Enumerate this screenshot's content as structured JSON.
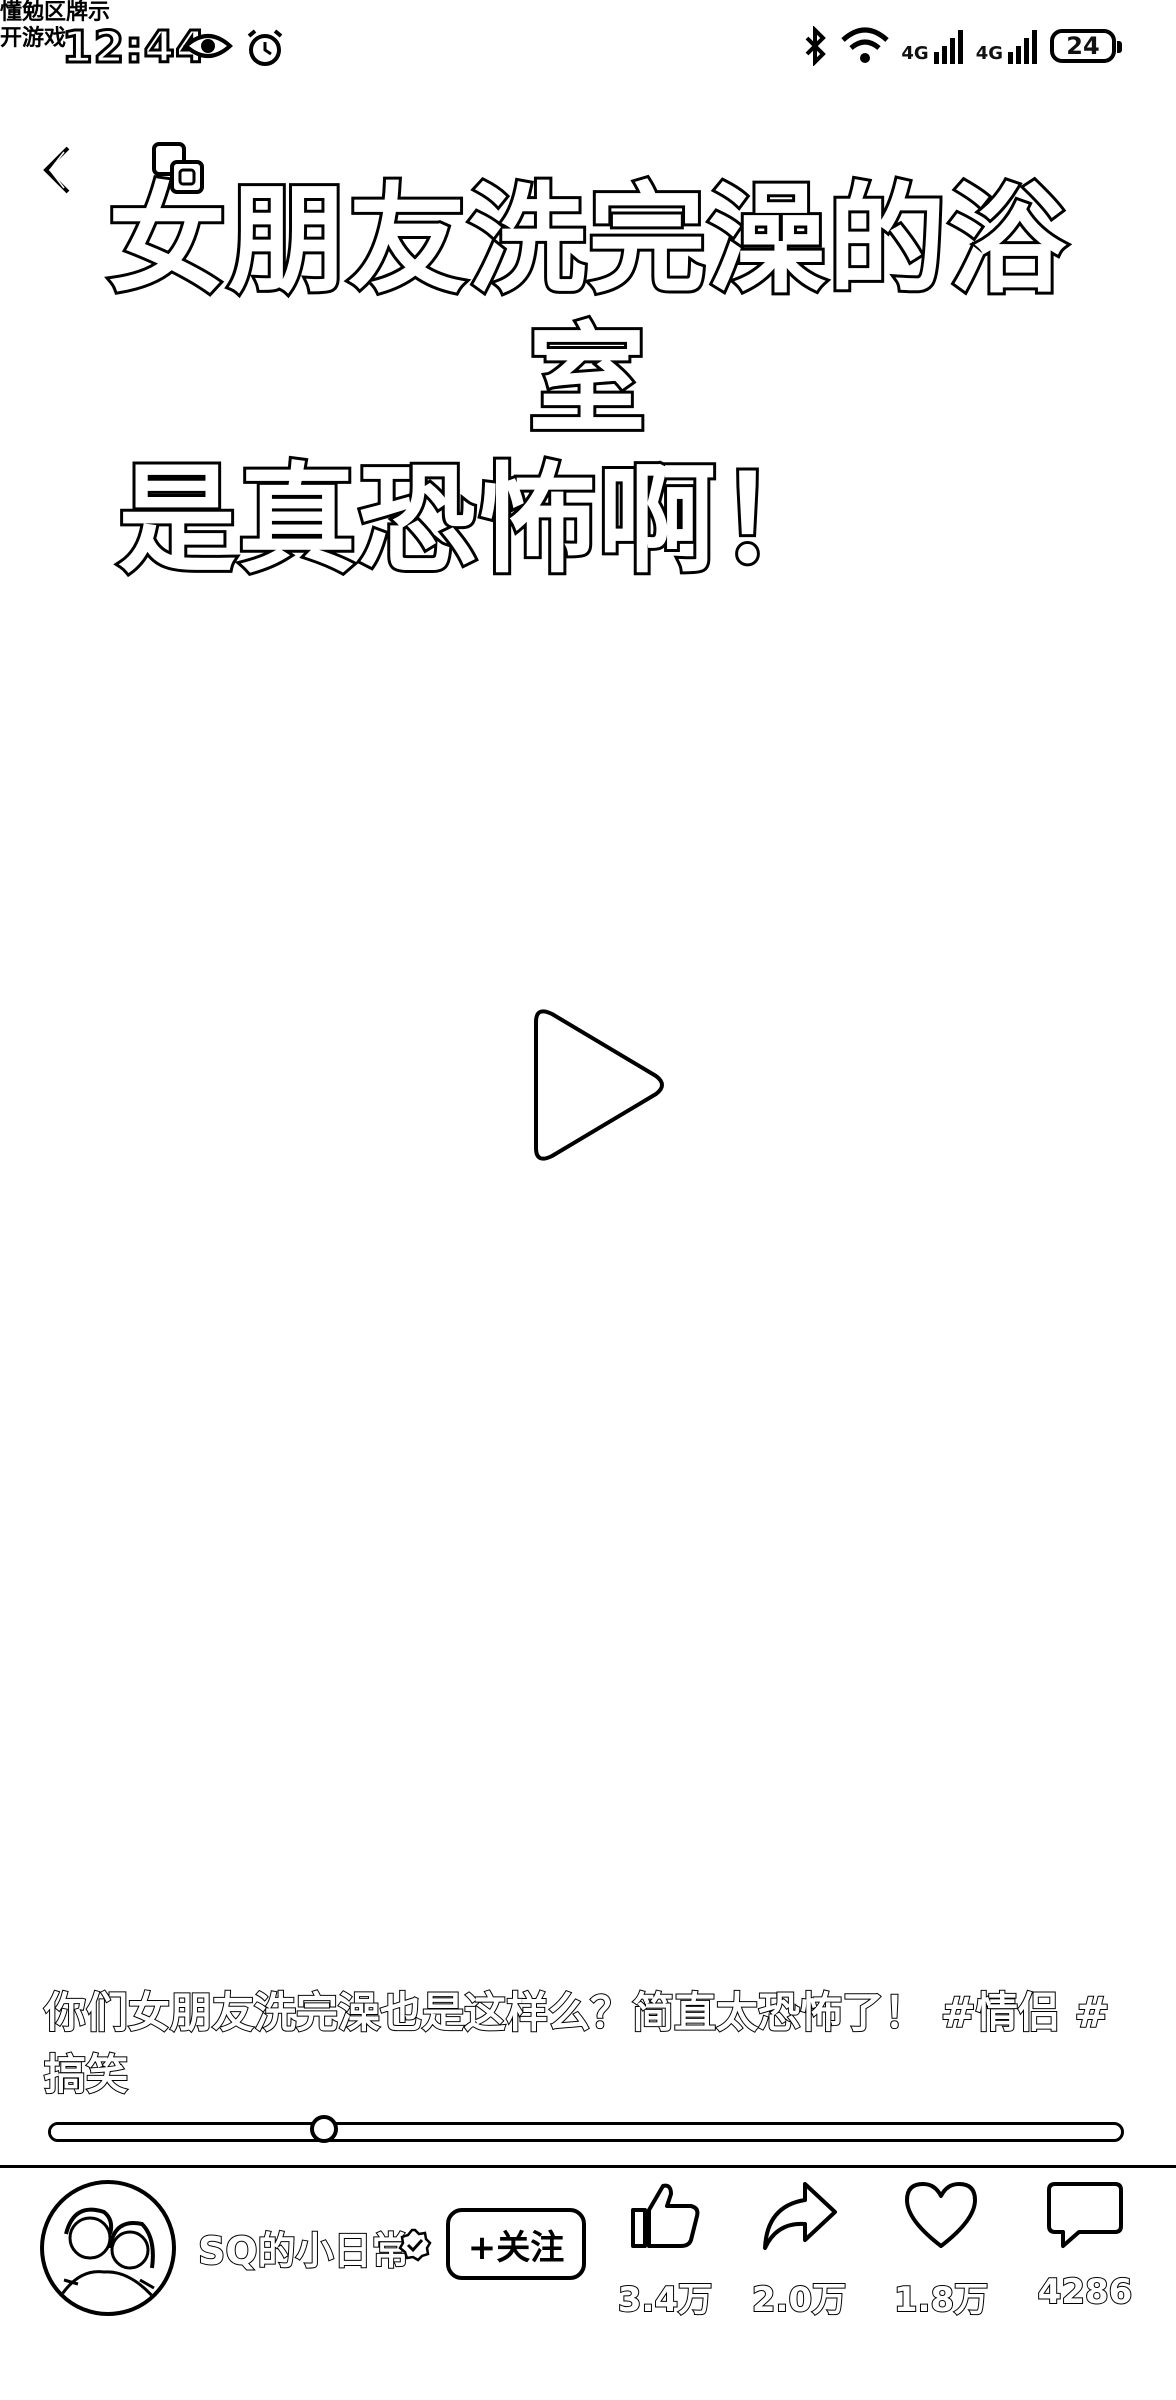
{
  "status_bar": {
    "notification_text": "懂勉区牌示\n开游戏",
    "time": "12:44",
    "network_1": "4G",
    "network_2": "4G",
    "battery": "24"
  },
  "video": {
    "title_line1": "女朋友洗完澡的浴室",
    "title_line2": "是真恐怖啊！",
    "description": "你们女朋友洗完澡也是这样么？简直太恐怖了！ #情侣 #搞笑",
    "progress_fraction": 0.255
  },
  "author": {
    "name": "SQ的小日常",
    "follow_label": "+关注"
  },
  "actions": {
    "like_count": "3.4万",
    "share_count": "2.0万",
    "favorite_count": "1.8万",
    "comment_count": "4286"
  },
  "icons": {
    "back": "chevron-left-icon",
    "pip": "picture-in-picture-icon",
    "play": "play-icon",
    "like": "thumbs-up-icon",
    "share": "share-arrow-icon",
    "favorite": "heart-icon",
    "comment": "comment-bubble-icon"
  }
}
